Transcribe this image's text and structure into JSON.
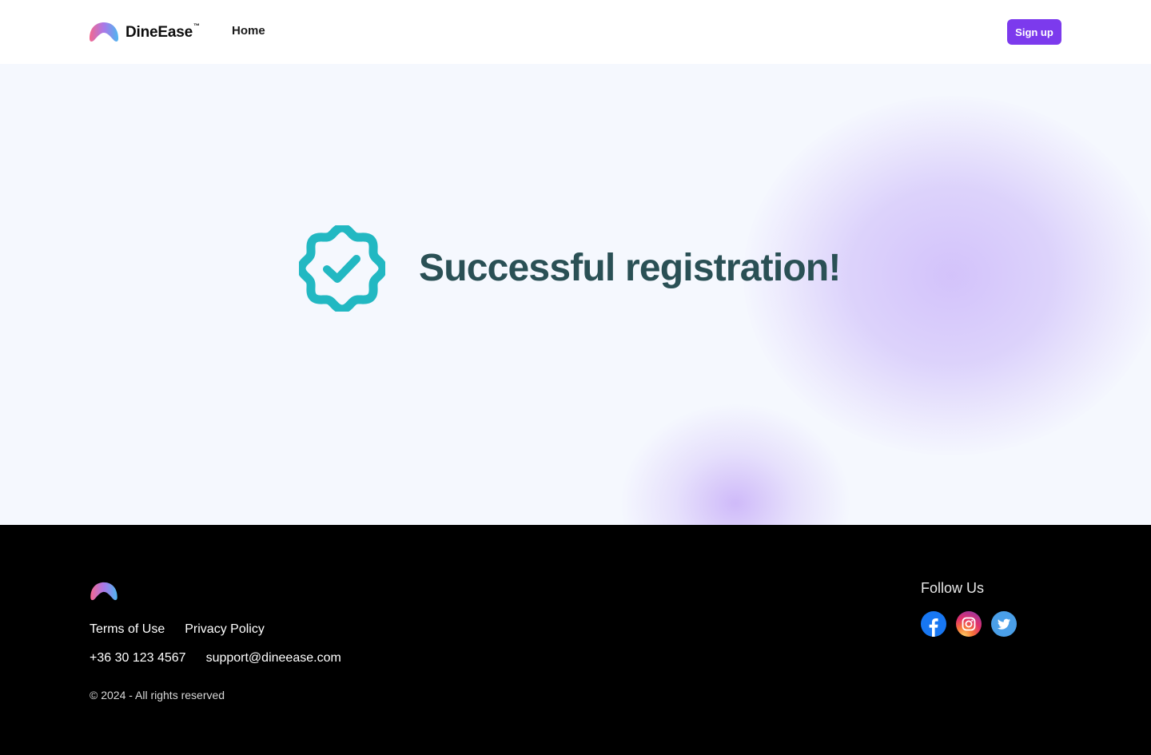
{
  "header": {
    "brand": "DineEase",
    "trademark": "™",
    "nav_home": "Home",
    "signup_label": "Sign up"
  },
  "main": {
    "title": "Successful registration!",
    "badge_icon": "verified-badge-check-icon",
    "badge_color": "#22b8c2",
    "title_color": "#2a5055"
  },
  "footer": {
    "links": [
      "Terms of Use",
      "Privacy Policy"
    ],
    "phone": "+36 30 123 4567",
    "email": "support@dineease.com",
    "copyright": "© 2024 - All rights reserved",
    "follow_title": "Follow Us",
    "social": [
      "facebook-icon",
      "instagram-icon",
      "twitter-icon"
    ]
  },
  "colors": {
    "accent": "#7c3aed",
    "footer_bg": "#000000",
    "main_bg": "#f5f8fe"
  }
}
